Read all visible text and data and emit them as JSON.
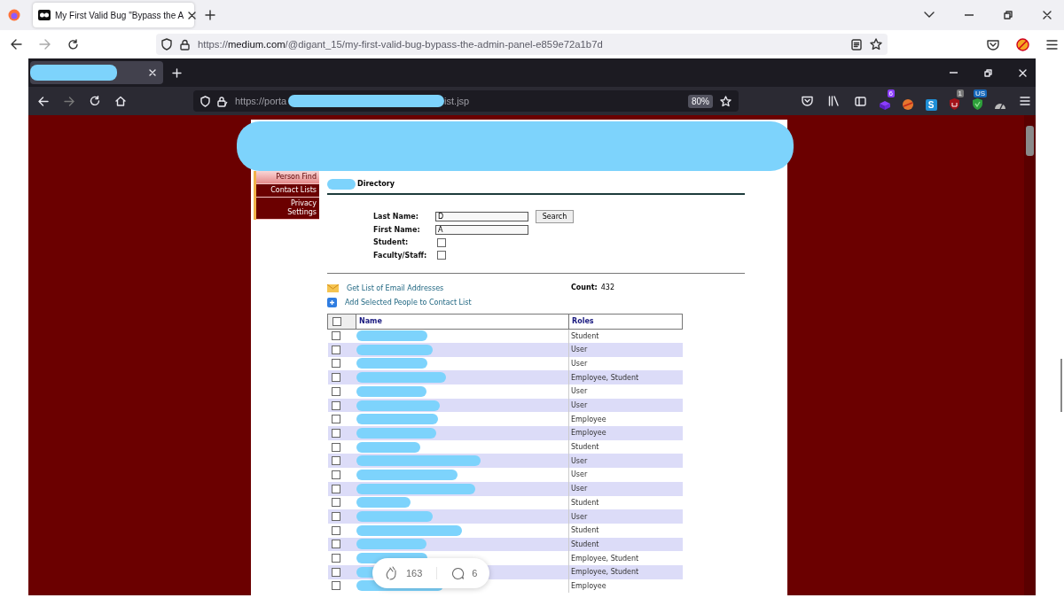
{
  "outer_browser": {
    "tabs": [
      {
        "title": "My First Valid Bug \"Bypass the A",
        "selected": true
      }
    ],
    "url": "https://**medium.com**/@digant_15/my-first-valid-bug-bypass-the-admin-panel-e859e72a1b7d"
  },
  "inner_browser": {
    "url_start": "https://porta",
    "url_end": "ist.jsp",
    "zoom": "80%",
    "extensions": [
      {
        "kind": "badge-purple",
        "badge": "6"
      },
      {
        "kind": "fox"
      },
      {
        "kind": "letter",
        "label": "S"
      },
      {
        "kind": "badge-red",
        "badge": "1"
      },
      {
        "kind": "badge-green",
        "badge": "US"
      },
      {
        "kind": "grey"
      }
    ]
  },
  "sidebar": {
    "items": [
      {
        "label": "Person Find",
        "selected": true
      },
      {
        "label": "Contact Lists",
        "selected": false
      },
      {
        "label": "Privacy Settings",
        "selected": false
      }
    ]
  },
  "heading": "Directory",
  "form": {
    "fields": [
      {
        "label": "Last Name:",
        "kind": "text",
        "value": "D"
      },
      {
        "label": "First Name:",
        "kind": "text",
        "value": "A"
      },
      {
        "label": "Student:",
        "kind": "checkbox",
        "checked": false
      },
      {
        "label": "Faculty/Staff:",
        "kind": "checkbox",
        "checked": false
      }
    ],
    "search_button": "Search"
  },
  "actions": [
    {
      "kind": "mail",
      "label": "Get List of Email Addresses"
    },
    {
      "kind": "add",
      "label": "Add Selected People to Contact List"
    }
  ],
  "count": {
    "label": "Count:",
    "value": "432"
  },
  "table": {
    "columns": [
      "Name",
      "Roles"
    ],
    "all_checked": false,
    "rows": [
      {
        "checked": false,
        "roles": "Student"
      },
      {
        "checked": false,
        "roles": "User"
      },
      {
        "checked": false,
        "roles": "User"
      },
      {
        "checked": false,
        "roles": "Employee, Student"
      },
      {
        "checked": false,
        "roles": "User"
      },
      {
        "checked": false,
        "roles": "User"
      },
      {
        "checked": false,
        "roles": "Employee"
      },
      {
        "checked": false,
        "roles": "Employee"
      },
      {
        "checked": false,
        "roles": "Student"
      },
      {
        "checked": false,
        "roles": "User"
      },
      {
        "checked": false,
        "roles": "User"
      },
      {
        "checked": false,
        "roles": "User"
      },
      {
        "checked": false,
        "roles": "Student"
      },
      {
        "checked": false,
        "roles": "User"
      },
      {
        "checked": false,
        "roles": "Student"
      },
      {
        "checked": false,
        "roles": "Student"
      },
      {
        "checked": false,
        "roles": "Employee, Student"
      },
      {
        "checked": false,
        "roles": "Employee, Student"
      },
      {
        "checked": false,
        "roles": "Employee"
      }
    ]
  },
  "reactions": {
    "claps": "163",
    "comments": "6"
  }
}
